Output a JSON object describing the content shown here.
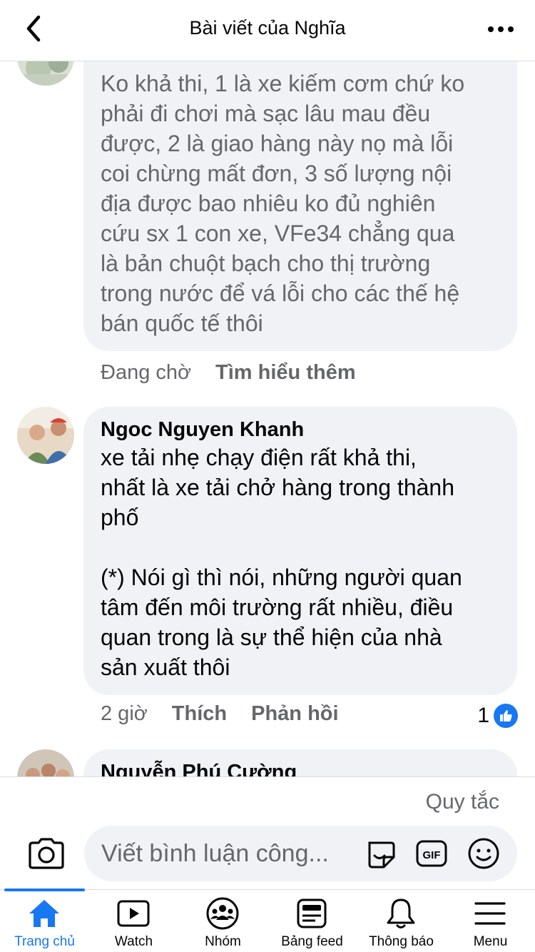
{
  "header": {
    "title": "Bài viết của Nghĩa"
  },
  "comments": [
    {
      "name": "",
      "text": "Ko khả thi, 1 là xe kiếm cơm chứ ko\nphải đi chơi mà sạc lâu mau đều\nđược, 2 là giao hàng này nọ mà lỗi\ncoi chừng mất đơn, 3 số lượng nội\nđịa được bao nhiêu ko đủ nghiên\ncứu sx 1 con xe, VFe34 chẳng qua\nlà bản chuột bạch cho thị trường\ntrong nước để vá lỗi cho các thế hệ\nbán quốc tế thôi",
      "status": "Đang chờ",
      "action": "Tìm hiểu thêm"
    },
    {
      "name": "Ngoc Nguyen Khanh",
      "text": "xe tải nhẹ chạy điện rất khả thi,\nnhất là xe tải chở hàng trong thành\nphố\n\n(*) Nói gì thì nói, những người quan\ntâm đến môi trường rất nhiều, điều\nquan trong là sự thể hiện của nhà\nsản xuất thôi",
      "time": "2 giờ",
      "like_label": "Thích",
      "reply_label": "Phản hồi",
      "reaction_count": "1"
    },
    {
      "name": "Nguyễn Phú Cường"
    }
  ],
  "composer": {
    "rules_label": "Quy tắc",
    "placeholder": "Viết bình luận công..."
  },
  "tabs": [
    {
      "label": "Trang chủ",
      "icon": "home-icon",
      "active": true
    },
    {
      "label": "Watch",
      "icon": "watch-icon"
    },
    {
      "label": "Nhóm",
      "icon": "groups-icon"
    },
    {
      "label": "Bảng feed",
      "icon": "feed-icon"
    },
    {
      "label": "Thông báo",
      "icon": "bell-icon"
    },
    {
      "label": "Menu",
      "icon": "menu-icon"
    }
  ],
  "colors": {
    "accent": "#1877f2",
    "bubble": "#f0f2f5",
    "secondary_text": "#65676b"
  }
}
